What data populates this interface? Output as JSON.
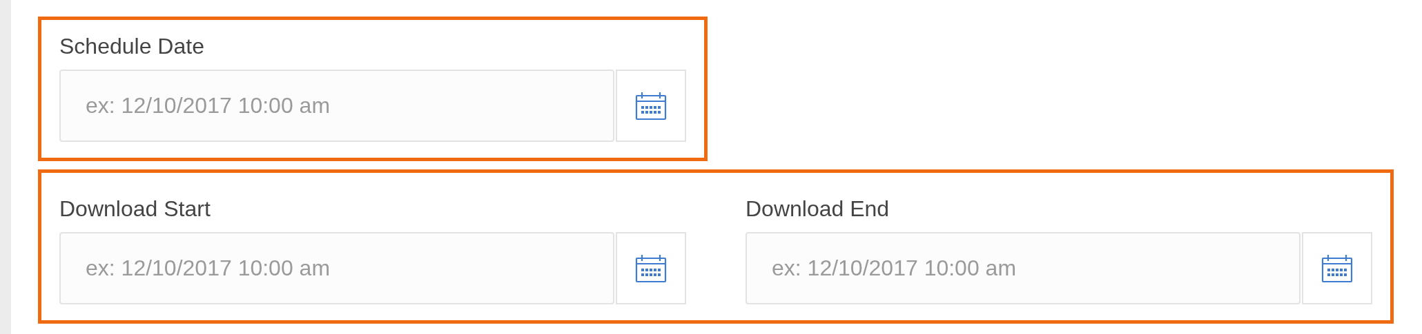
{
  "groups": [
    {
      "fields": [
        {
          "label": "Schedule Date",
          "placeholder": "ex: 12/10/2017 10:00 am"
        }
      ]
    },
    {
      "fields": [
        {
          "label": "Download Start",
          "placeholder": "ex: 12/10/2017 10:00 am"
        },
        {
          "label": "Download End",
          "placeholder": "ex: 12/10/2017 10:00 am"
        }
      ]
    }
  ]
}
